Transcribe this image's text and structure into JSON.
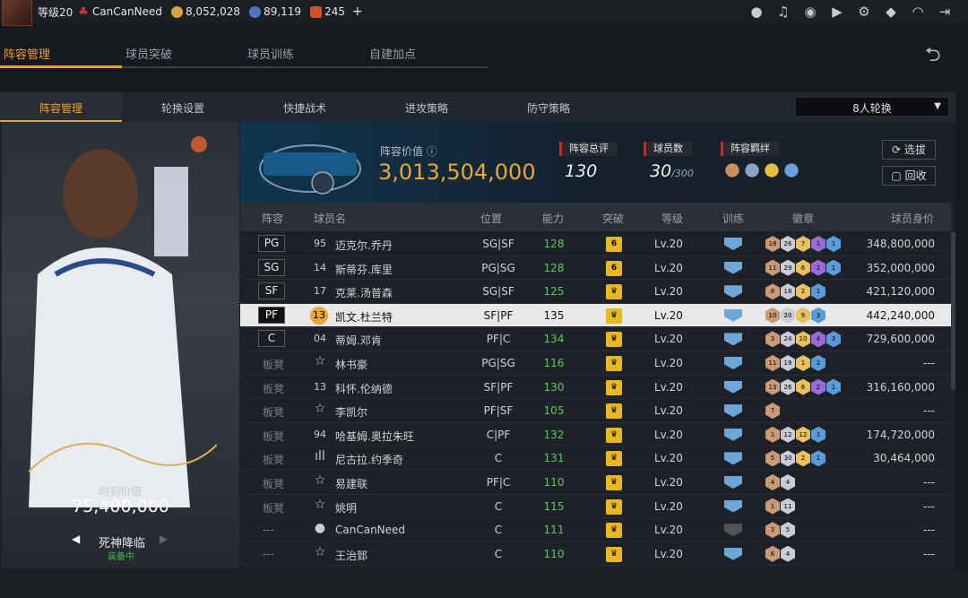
{
  "topbar": {
    "level": "等级20",
    "username": "CanCanNeed",
    "gold": "8,052,028",
    "stars": "89,119",
    "diamonds": "245",
    "plus": "+",
    "icons": [
      "person-icon",
      "bell-icon",
      "friends-icon",
      "video-icon",
      "gear-icon",
      "shield-icon",
      "headset-icon",
      "exit-icon"
    ]
  },
  "main_tabs": [
    "阵容管理",
    "球员突破",
    "球员训练",
    "自建加点"
  ],
  "sub_tabs": [
    "阵容管理",
    "轮换设置",
    "快捷战术",
    "进攻策略",
    "防守策略"
  ],
  "rotation_select": "8人轮换",
  "card": {
    "label": "时刻价值",
    "value": "75,400,000",
    "skill": "死神降临",
    "status": "装备中"
  },
  "info": {
    "value_label": "阵容价值",
    "value": "3,013,504,000",
    "rating_label": "阵容总评",
    "rating": "130",
    "count_label": "球员数",
    "count": "30",
    "count_max": "/300",
    "bond_label": "阵容羁绊",
    "btn_select": "选拔",
    "btn_recycle": "回收"
  },
  "table_headers": [
    "阵容",
    "球员名",
    "位置",
    "能力",
    "突破",
    "等级",
    "训练",
    "徽章",
    "球员身价"
  ],
  "colors": {
    "accent": "#f0a020",
    "ability": "#5ec85e"
  },
  "rows": [
    {
      "slot": "PG",
      "num": "95",
      "name": "迈克尔.乔丹",
      "pos": "SG|SF",
      "ability": "128",
      "brk": "6",
      "lv": "Lv.20",
      "medals": [
        [
          "18",
          "br"
        ],
        [
          "26",
          "si"
        ],
        [
          "7",
          "go"
        ],
        [
          "1",
          "pu"
        ],
        [
          "1",
          "bl"
        ]
      ],
      "price": "348,800,000"
    },
    {
      "slot": "SG",
      "num": "14",
      "name": "斯蒂芬.库里",
      "pos": "PG|SG",
      "ability": "128",
      "brk": "6",
      "lv": "Lv.20",
      "medals": [
        [
          "11",
          "br"
        ],
        [
          "29",
          "si"
        ],
        [
          "6",
          "go"
        ],
        [
          "2",
          "pu"
        ],
        [
          "1",
          "bl"
        ]
      ],
      "price": "352,000,000"
    },
    {
      "slot": "SF",
      "num": "17",
      "name": "克莱.汤普森",
      "pos": "SG|SF",
      "ability": "125",
      "brk": "♛",
      "lv": "Lv.20",
      "medals": [
        [
          "8",
          "br"
        ],
        [
          "18",
          "si"
        ],
        [
          "2",
          "go"
        ],
        [
          "1",
          "bl"
        ]
      ],
      "price": "421,120,000"
    },
    {
      "slot": "PF",
      "num": "13",
      "name": "凯文.杜兰特",
      "pos": "SF|PF",
      "ability": "135",
      "brk": "♛",
      "lv": "Lv.20",
      "medals": [
        [
          "10",
          "br"
        ],
        [
          "20",
          "si"
        ],
        [
          "9",
          "go"
        ],
        [
          "3",
          "bl"
        ]
      ],
      "price": "442,240,000",
      "sel": true
    },
    {
      "slot": "C",
      "num": "04",
      "name": "蒂姆.邓肯",
      "pos": "PF|C",
      "ability": "134",
      "brk": "♛",
      "lv": "Lv.20",
      "medals": [
        [
          "3",
          "br"
        ],
        [
          "24",
          "si"
        ],
        [
          "10",
          "go"
        ],
        [
          "4",
          "pu"
        ],
        [
          "3",
          "bl"
        ]
      ],
      "price": "729,600,000"
    },
    {
      "slot": "板凳",
      "num": "☆",
      "name": "林书豪",
      "pos": "PG|SG",
      "ability": "116",
      "brk": "♛",
      "lv": "Lv.20",
      "medals": [
        [
          "11",
          "br"
        ],
        [
          "19",
          "si"
        ],
        [
          "1",
          "go"
        ],
        [
          "2",
          "bl"
        ]
      ],
      "price": "---"
    },
    {
      "slot": "板凳",
      "num": "13",
      "name": "科怀.伦纳德",
      "pos": "SF|PF",
      "ability": "130",
      "brk": "♛",
      "lv": "Lv.20",
      "medals": [
        [
          "13",
          "br"
        ],
        [
          "26",
          "si"
        ],
        [
          "6",
          "go"
        ],
        [
          "2",
          "pu"
        ],
        [
          "1",
          "bl"
        ]
      ],
      "price": "316,160,000"
    },
    {
      "slot": "板凳",
      "num": "☆",
      "name": "李凯尔",
      "pos": "PF|SF",
      "ability": "105",
      "brk": "♛",
      "lv": "Lv.20",
      "medals": [
        [
          "7",
          "br"
        ]
      ],
      "price": "---"
    },
    {
      "slot": "板凳",
      "num": "94",
      "name": "哈基姆.奥拉朱旺",
      "pos": "C|PF",
      "ability": "132",
      "brk": "♛",
      "lv": "Lv.20",
      "medals": [
        [
          "1",
          "br"
        ],
        [
          "12",
          "si"
        ],
        [
          "12",
          "go"
        ],
        [
          "1",
          "bl"
        ]
      ],
      "price": "174,720,000"
    },
    {
      "slot": "板凳",
      "num": "ıll",
      "name": "尼古拉.约季奇",
      "pos": "C",
      "ability": "131",
      "brk": "♛",
      "lv": "Lv.20",
      "medals": [
        [
          "5",
          "br"
        ],
        [
          "30",
          "si"
        ],
        [
          "2",
          "go"
        ],
        [
          "1",
          "bl"
        ]
      ],
      "price": "30,464,000"
    },
    {
      "slot": "板凳",
      "num": "☆",
      "name": "易建联",
      "pos": "PF|C",
      "ability": "110",
      "brk": "♛",
      "lv": "Lv.20",
      "medals": [
        [
          "4",
          "br"
        ],
        [
          "4",
          "si"
        ]
      ],
      "price": "---"
    },
    {
      "slot": "板凳",
      "num": "☆",
      "name": "姚明",
      "pos": "C",
      "ability": "115",
      "brk": "♛",
      "lv": "Lv.20",
      "medals": [
        [
          "1",
          "br"
        ],
        [
          "11",
          "si"
        ]
      ],
      "price": "---"
    },
    {
      "slot": "---",
      "num": "●",
      "name": "CanCanNeed",
      "pos": "C",
      "ability": "111",
      "brk": "♛",
      "lv": "Lv.20",
      "medals": [
        [
          "3",
          "br"
        ],
        [
          "5",
          "si"
        ]
      ],
      "price": "---",
      "grey_train": true
    },
    {
      "slot": "---",
      "num": "☆",
      "name": "王治郅",
      "pos": "C",
      "ability": "110",
      "brk": "♛",
      "lv": "Lv.20",
      "medals": [
        [
          "6",
          "br"
        ],
        [
          "4",
          "si"
        ]
      ],
      "price": "---"
    }
  ]
}
